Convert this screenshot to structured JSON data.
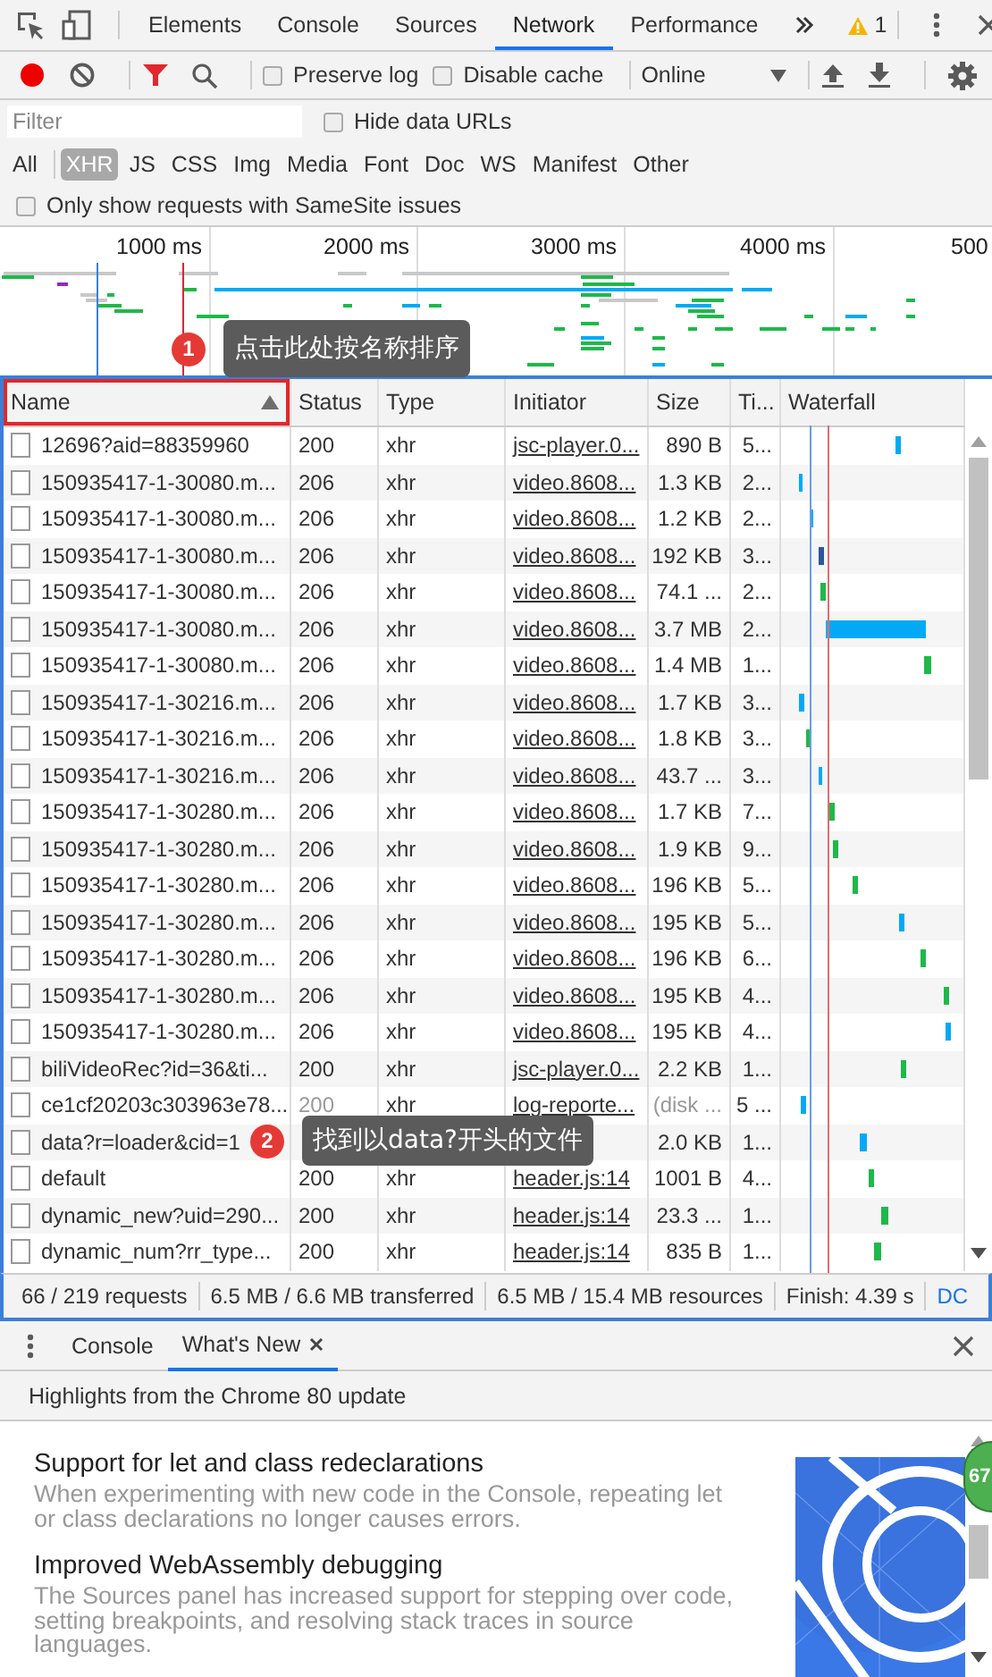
{
  "top_tabs": [
    {
      "label": "Elements",
      "selected": false
    },
    {
      "label": "Console",
      "selected": false
    },
    {
      "label": "Sources",
      "selected": false
    },
    {
      "label": "Network",
      "selected": true
    },
    {
      "label": "Performance",
      "selected": false
    }
  ],
  "warning_count": "1",
  "toolbar": {
    "recording": true,
    "filter_shown": true,
    "preserve_log": {
      "label": "Preserve log",
      "checked": false
    },
    "disable_cache": {
      "label": "Disable cache",
      "checked": false
    },
    "throttling": "Online"
  },
  "filter": {
    "placeholder": "Filter",
    "hide_data_urls": {
      "label": "Hide data URLs",
      "checked": false
    }
  },
  "type_filters": [
    {
      "label": "All",
      "selected": false
    },
    {
      "label": "XHR",
      "selected": true
    },
    {
      "label": "JS",
      "selected": false
    },
    {
      "label": "CSS",
      "selected": false
    },
    {
      "label": "Img",
      "selected": false
    },
    {
      "label": "Media",
      "selected": false
    },
    {
      "label": "Font",
      "selected": false
    },
    {
      "label": "Doc",
      "selected": false
    },
    {
      "label": "WS",
      "selected": false
    },
    {
      "label": "Manifest",
      "selected": false
    },
    {
      "label": "Other",
      "selected": false
    }
  ],
  "samesite": {
    "label": "Only show requests with SameSite issues",
    "checked": false
  },
  "overview": {
    "ticks": [
      "1000 ms",
      "2000 ms",
      "3000 ms",
      "4000 ms",
      "500"
    ]
  },
  "table": {
    "columns": [
      {
        "label": "Name",
        "sorted": true,
        "highlighted": true
      },
      {
        "label": "Status",
        "sorted": false,
        "highlighted": false
      },
      {
        "label": "Type",
        "sorted": false,
        "highlighted": false
      },
      {
        "label": "Initiator",
        "sorted": false,
        "highlighted": false
      },
      {
        "label": "Size",
        "sorted": false,
        "highlighted": false
      },
      {
        "label": "Ti...",
        "sorted": false,
        "highlighted": false
      },
      {
        "label": "Waterfall",
        "sorted": false,
        "highlighted": false
      }
    ],
    "rows": [
      {
        "name": "12696?aid=88359960",
        "status": "200",
        "type": "xhr",
        "initiator": "jsc-player.0...",
        "size": "890 B",
        "time": "5...",
        "cached": false
      },
      {
        "name": "150935417-1-30080.m...",
        "status": "206",
        "type": "xhr",
        "initiator": "video.8608...",
        "size": "1.3 KB",
        "time": "2...",
        "cached": false
      },
      {
        "name": "150935417-1-30080.m...",
        "status": "206",
        "type": "xhr",
        "initiator": "video.8608...",
        "size": "1.2 KB",
        "time": "2...",
        "cached": false
      },
      {
        "name": "150935417-1-30080.m...",
        "status": "206",
        "type": "xhr",
        "initiator": "video.8608...",
        "size": "192 KB",
        "time": "3...",
        "cached": false
      },
      {
        "name": "150935417-1-30080.m...",
        "status": "206",
        "type": "xhr",
        "initiator": "video.8608...",
        "size": "74.1 ...",
        "time": "2...",
        "cached": false
      },
      {
        "name": "150935417-1-30080.m...",
        "status": "206",
        "type": "xhr",
        "initiator": "video.8608...",
        "size": "3.7 MB",
        "time": "2...",
        "cached": false
      },
      {
        "name": "150935417-1-30080.m...",
        "status": "206",
        "type": "xhr",
        "initiator": "video.8608...",
        "size": "1.4 MB",
        "time": "1...",
        "cached": false
      },
      {
        "name": "150935417-1-30216.m...",
        "status": "206",
        "type": "xhr",
        "initiator": "video.8608...",
        "size": "1.7 KB",
        "time": "3...",
        "cached": false
      },
      {
        "name": "150935417-1-30216.m...",
        "status": "206",
        "type": "xhr",
        "initiator": "video.8608...",
        "size": "1.8 KB",
        "time": "3...",
        "cached": false
      },
      {
        "name": "150935417-1-30216.m...",
        "status": "206",
        "type": "xhr",
        "initiator": "video.8608...",
        "size": "43.7 ...",
        "time": "3...",
        "cached": false
      },
      {
        "name": "150935417-1-30280.m...",
        "status": "206",
        "type": "xhr",
        "initiator": "video.8608...",
        "size": "1.7 KB",
        "time": "7...",
        "cached": false
      },
      {
        "name": "150935417-1-30280.m...",
        "status": "206",
        "type": "xhr",
        "initiator": "video.8608...",
        "size": "1.9 KB",
        "time": "9...",
        "cached": false
      },
      {
        "name": "150935417-1-30280.m...",
        "status": "206",
        "type": "xhr",
        "initiator": "video.8608...",
        "size": "196 KB",
        "time": "5...",
        "cached": false
      },
      {
        "name": "150935417-1-30280.m...",
        "status": "206",
        "type": "xhr",
        "initiator": "video.8608...",
        "size": "195 KB",
        "time": "5...",
        "cached": false
      },
      {
        "name": "150935417-1-30280.m...",
        "status": "206",
        "type": "xhr",
        "initiator": "video.8608...",
        "size": "196 KB",
        "time": "6...",
        "cached": false
      },
      {
        "name": "150935417-1-30280.m...",
        "status": "206",
        "type": "xhr",
        "initiator": "video.8608...",
        "size": "195 KB",
        "time": "4...",
        "cached": false
      },
      {
        "name": "150935417-1-30280.m...",
        "status": "206",
        "type": "xhr",
        "initiator": "video.8608...",
        "size": "195 KB",
        "time": "4...",
        "cached": false
      },
      {
        "name": "biliVideoRec?id=36&ti...",
        "status": "200",
        "type": "xhr",
        "initiator": "jsc-player.0...",
        "size": "2.2 KB",
        "time": "1...",
        "cached": false
      },
      {
        "name": "ce1cf20203c303963e78...",
        "status": "200",
        "type": "xhr",
        "initiator": "log-reporte...",
        "size": "(disk ...",
        "time": "5 ...",
        "cached": true
      },
      {
        "name": "data?r=loader&cid=1",
        "size": "2.0 KB",
        "time": "1...",
        "cached": false
      },
      {
        "name": "default",
        "status": "200",
        "type": "xhr",
        "initiator": "header.js:14",
        "size": "1001 B",
        "time": "4...",
        "cached": false
      },
      {
        "name": "dynamic_new?uid=290...",
        "status": "200",
        "type": "xhr",
        "initiator": "header.js:14",
        "size": "23.3 ...",
        "time": "1...",
        "cached": false
      },
      {
        "name": "dynamic_num?rr_type...",
        "status": "200",
        "type": "xhr",
        "initiator": "header.js:14",
        "size": "835 B",
        "time": "1...",
        "cached": false
      }
    ]
  },
  "callouts": [
    {
      "number": "1",
      "text": "点击此处按名称排序"
    },
    {
      "number": "2",
      "text": "找到以data?开头的文件"
    }
  ],
  "status_bar": [
    "66 / 219 requests",
    "6.5 MB / 6.6 MB transferred",
    "6.5 MB / 15.4 MB resources",
    "Finish: 4.39 s",
    "DC"
  ],
  "drawer": {
    "tabs": [
      {
        "label": "Console",
        "selected": false,
        "closable": false
      },
      {
        "label": "What's New",
        "selected": true,
        "closable": true
      }
    ],
    "banner": "Highlights from the Chrome 80 update",
    "articles": [
      {
        "title": "Support for let and class redeclarations",
        "body": "When experimenting with new code in the Console, repeating let or class declarations no longer causes errors."
      },
      {
        "title": "Improved WebAssembly debugging",
        "body": "The Sources panel has increased support for stepping over code, setting breakpoints, and resolving stack traces in source languages."
      }
    ],
    "badge": "67"
  }
}
